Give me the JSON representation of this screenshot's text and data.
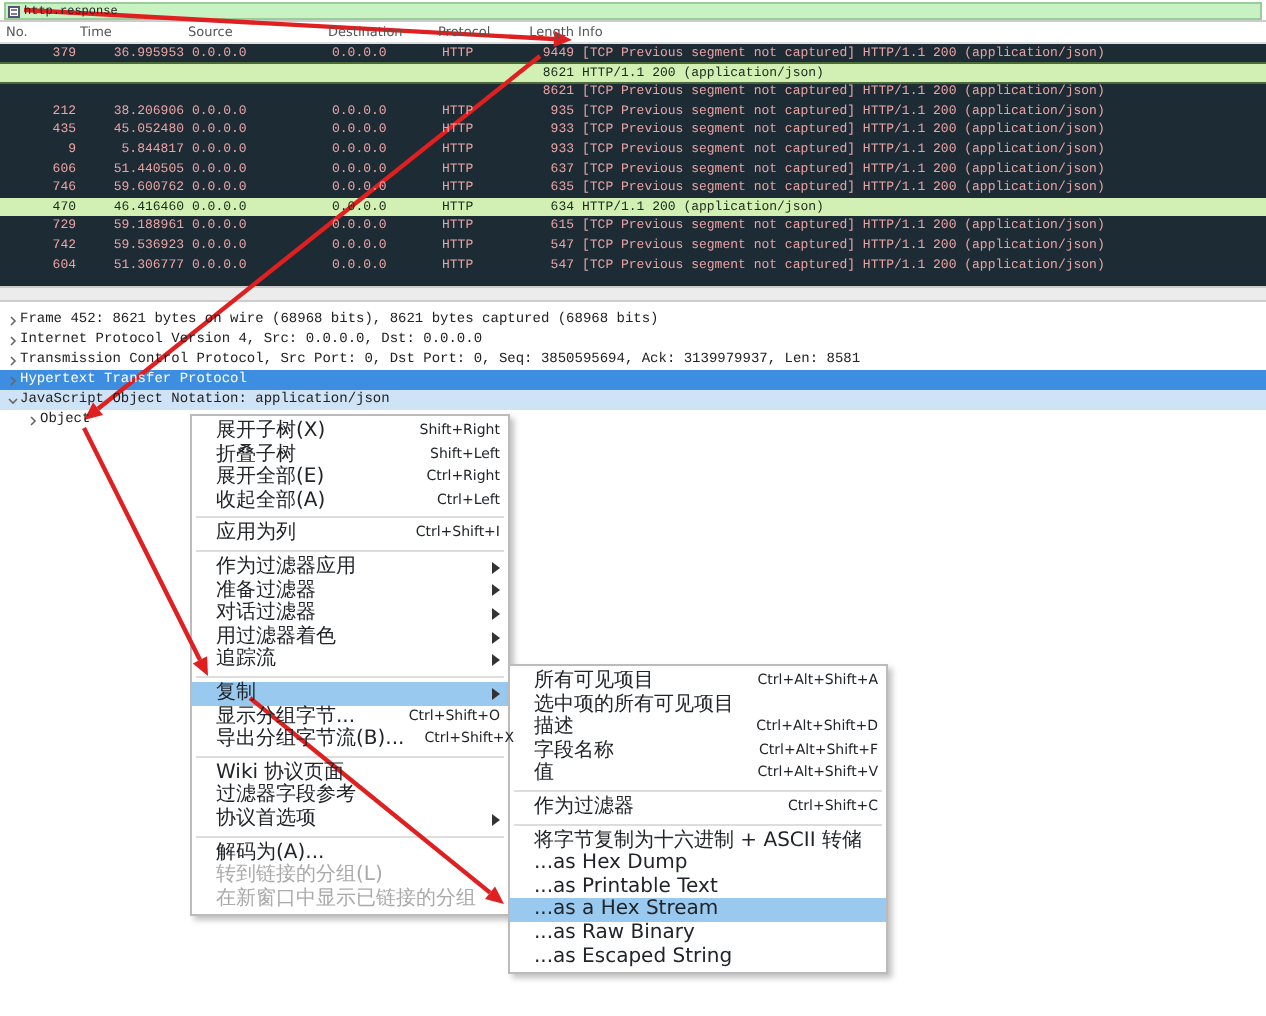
{
  "filter": {
    "value": "http.response"
  },
  "packet_list": {
    "columns": [
      "No.",
      "Time",
      "Source",
      "Destination",
      "Protocol",
      "Length",
      "Info"
    ],
    "rows": [
      {
        "no": "379",
        "time": "36.995953",
        "source": "0.0.0.0",
        "destination": "0.0.0.0",
        "protocol": "HTTP",
        "length": "9449",
        "info": "[TCP Previous segment not captured] HTTP/1.1 200   (application/json)",
        "color": "#1d2b35",
        "selected": false
      },
      {
        "length": "8621",
        "info": "HTTP/1.1 200   (application/json)",
        "color": "#d3f0b4",
        "selected": true
      },
      {
        "length": "8621",
        "info": "[TCP Previous segment not captured] HTTP/1.1 200   (application/json)",
        "color": "#1d2b35",
        "selected": false
      },
      {
        "no": "212",
        "time": "38.206906",
        "source": "0.0.0.0",
        "destination": "0.0.0.0",
        "protocol": "HTTP",
        "length": "935",
        "info": "[TCP Previous segment not captured] HTTP/1.1 200   (application/json)",
        "color": "#1d2b35",
        "selected": false
      },
      {
        "no": "435",
        "time": "45.052480",
        "source": "0.0.0.0",
        "destination": "0.0.0.0",
        "protocol": "HTTP",
        "length": "933",
        "info": "[TCP Previous segment not captured] HTTP/1.1 200   (application/json)",
        "color": "#1d2b35",
        "selected": false
      },
      {
        "no": "9",
        "time": "5.844817",
        "source": "0.0.0.0",
        "destination": "0.0.0.0",
        "protocol": "HTTP",
        "length": "933",
        "info": "[TCP Previous segment not captured] HTTP/1.1 200   (application/json)",
        "color": "#1d2b35",
        "selected": false
      },
      {
        "no": "606",
        "time": "51.440505",
        "source": "0.0.0.0",
        "destination": "0.0.0.0",
        "protocol": "HTTP",
        "length": "637",
        "info": "[TCP Previous segment not captured] HTTP/1.1 200   (application/json)",
        "color": "#1d2b35",
        "selected": false
      },
      {
        "no": "746",
        "time": "59.600762",
        "source": "0.0.0.0",
        "destination": "0.0.0.0",
        "protocol": "HTTP",
        "length": "635",
        "info": "[TCP Previous segment not captured] HTTP/1.1 200   (application/json)",
        "color": "#1d2b35",
        "selected": false
      },
      {
        "no": "470",
        "time": "46.416460",
        "source": "0.0.0.0",
        "destination": "0.0.0.0",
        "protocol": "HTTP",
        "length": "634",
        "info": "HTTP/1.1 200   (application/json)",
        "color": "#d3f0b4",
        "selected": false
      },
      {
        "no": "729",
        "time": "59.188961",
        "source": "0.0.0.0",
        "destination": "0.0.0.0",
        "protocol": "HTTP",
        "length": "615",
        "info": "[TCP Previous segment not captured] HTTP/1.1 200   (application/json)",
        "color": "#1d2b35",
        "selected": false
      },
      {
        "no": "742",
        "time": "59.536923",
        "source": "0.0.0.0",
        "destination": "0.0.0.0",
        "protocol": "HTTP",
        "length": "547",
        "info": "[TCP Previous segment not captured] HTTP/1.1 200   (application/json)",
        "color": "#1d2b35",
        "selected": false
      },
      {
        "no": "604",
        "time": "51.306777",
        "source": "0.0.0.0",
        "destination": "0.0.0.0",
        "protocol": "HTTP",
        "length": "547",
        "info": "[TCP Previous segment not captured] HTTP/1.1 200   (application/json)",
        "color": "#1d2b35",
        "selected": false
      }
    ]
  },
  "packet_details": [
    {
      "text": "Frame 452: 8621 bytes on wire (68968 bits), 8621 bytes captured (68968 bits)",
      "expanded": false,
      "selected": false
    },
    {
      "text": "Internet Protocol Version 4, Src: 0.0.0.0, Dst: 0.0.0.0",
      "expanded": false,
      "selected": false
    },
    {
      "text": "Transmission Control Protocol, Src Port: 0, Dst Port: 0, Seq: 3850595694, Ack: 3139979937, Len: 8581",
      "expanded": false,
      "selected": false
    },
    {
      "text": "Hypertext Transfer Protocol",
      "expanded": false,
      "selected": true
    },
    {
      "text": "JavaScript Object Notation: application/json",
      "expanded": true,
      "selected": false,
      "children": [
        {
          "text": "Object",
          "expanded": false,
          "selected": false
        }
      ]
    }
  ],
  "context_menu": [
    {
      "kind": "item",
      "label": "展开子树(X)",
      "shortcut": "Shift+Right",
      "submenu": false,
      "selected": false,
      "disabled": false
    },
    {
      "kind": "item",
      "label": "折叠子树",
      "shortcut": "Shift+Left",
      "submenu": false,
      "selected": false,
      "disabled": false
    },
    {
      "kind": "item",
      "label": "展开全部(E)",
      "shortcut": "Ctrl+Right",
      "submenu": false,
      "selected": false,
      "disabled": false
    },
    {
      "kind": "item",
      "label": "收起全部(A)",
      "shortcut": "Ctrl+Left",
      "submenu": false,
      "selected": false,
      "disabled": false
    },
    {
      "kind": "separator"
    },
    {
      "kind": "item",
      "label": "应用为列",
      "shortcut": "Ctrl+Shift+I",
      "submenu": false,
      "selected": false,
      "disabled": false
    },
    {
      "kind": "separator"
    },
    {
      "kind": "item",
      "label": "作为过滤器应用",
      "submenu": true,
      "selected": false,
      "disabled": false
    },
    {
      "kind": "item",
      "label": "准备过滤器",
      "submenu": true,
      "selected": false,
      "disabled": false
    },
    {
      "kind": "item",
      "label": "对话过滤器",
      "submenu": true,
      "selected": false,
      "disabled": false
    },
    {
      "kind": "item",
      "label": "用过滤器着色",
      "submenu": true,
      "selected": false,
      "disabled": false
    },
    {
      "kind": "item",
      "label": "追踪流",
      "submenu": true,
      "selected": false,
      "disabled": false
    },
    {
      "kind": "separator"
    },
    {
      "kind": "item",
      "label": "复制",
      "submenu": true,
      "selected": true,
      "disabled": false
    },
    {
      "kind": "item",
      "label": "显示分组字节...",
      "shortcut": "Ctrl+Shift+O",
      "submenu": false,
      "selected": false,
      "disabled": false
    },
    {
      "kind": "item",
      "label": "导出分组字节流(B)...",
      "shortcut": "Ctrl+Shift+X",
      "submenu": false,
      "selected": false,
      "disabled": false
    },
    {
      "kind": "separator"
    },
    {
      "kind": "item",
      "label": "Wiki 协议页面",
      "submenu": false,
      "selected": false,
      "disabled": false
    },
    {
      "kind": "item",
      "label": "过滤器字段参考",
      "submenu": false,
      "selected": false,
      "disabled": false
    },
    {
      "kind": "item",
      "label": "协议首选项",
      "submenu": true,
      "selected": false,
      "disabled": false
    },
    {
      "kind": "separator"
    },
    {
      "kind": "item",
      "label": "解码为(A)...",
      "submenu": false,
      "selected": false,
      "disabled": false
    },
    {
      "kind": "item",
      "label": "转到链接的分组(L)",
      "submenu": false,
      "selected": false,
      "disabled": true
    },
    {
      "kind": "item",
      "label": "在新窗口中显示已链接的分组",
      "submenu": false,
      "selected": false,
      "disabled": true
    }
  ],
  "copy_submenu": [
    {
      "kind": "item",
      "label": "所有可见项目",
      "shortcut": "Ctrl+Alt+Shift+A",
      "selected": false
    },
    {
      "kind": "item",
      "label": "选中项的所有可见项目",
      "selected": false
    },
    {
      "kind": "item",
      "label": "描述",
      "shortcut": "Ctrl+Alt+Shift+D",
      "selected": false
    },
    {
      "kind": "item",
      "label": "字段名称",
      "shortcut": "Ctrl+Alt+Shift+F",
      "selected": false
    },
    {
      "kind": "item",
      "label": "值",
      "shortcut": "Ctrl+Alt+Shift+V",
      "selected": false
    },
    {
      "kind": "separator"
    },
    {
      "kind": "item",
      "label": "作为过滤器",
      "shortcut": "Ctrl+Shift+C",
      "selected": false
    },
    {
      "kind": "separator"
    },
    {
      "kind": "item",
      "label": "将字节复制为十六进制 + ASCII 转储",
      "selected": false
    },
    {
      "kind": "item",
      "label": "...as Hex Dump",
      "selected": false
    },
    {
      "kind": "item",
      "label": "...as Printable Text",
      "selected": false
    },
    {
      "kind": "item",
      "label": "...as a Hex Stream",
      "selected": true
    },
    {
      "kind": "item",
      "label": "...as Raw Binary",
      "selected": false
    },
    {
      "kind": "item",
      "label": "...as Escaped String",
      "selected": false
    }
  ]
}
